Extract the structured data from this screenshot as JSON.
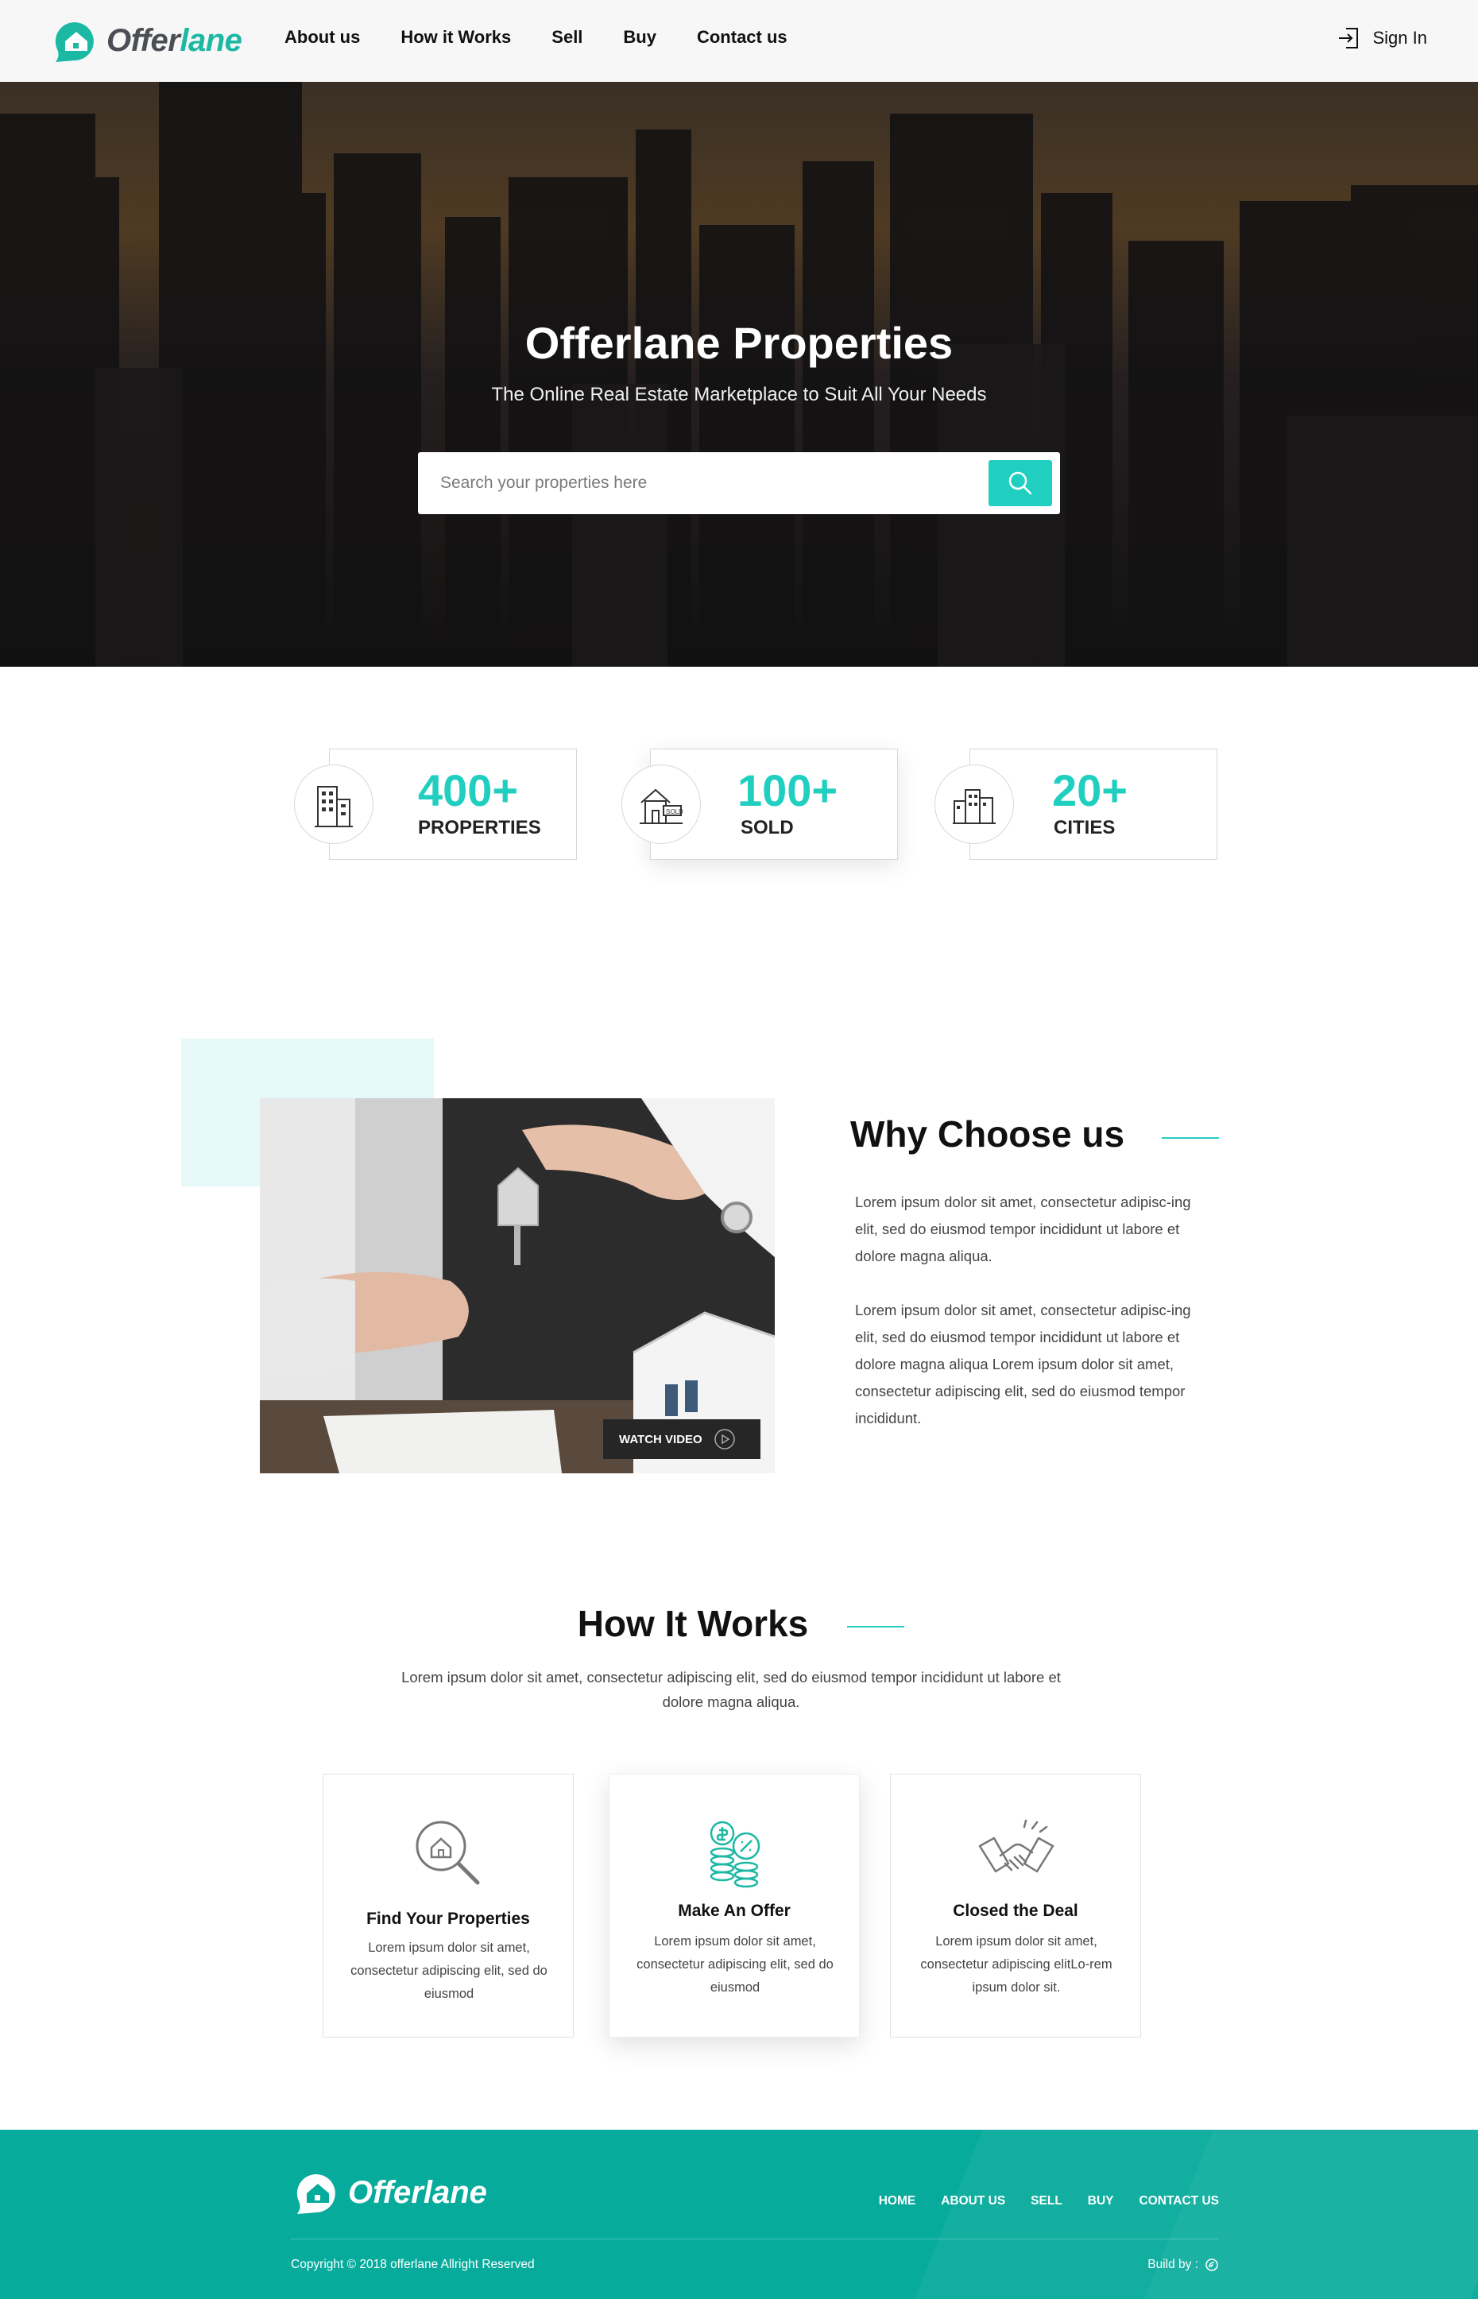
{
  "brand": {
    "name_part1": "Offer",
    "name_part2": "lane",
    "footer_name": "Offerlane",
    "accent": "#21cfc0",
    "footer_bg": "#06ab9c"
  },
  "nav": {
    "items": [
      {
        "label": "About us"
      },
      {
        "label": "How it Works"
      },
      {
        "label": "Sell"
      },
      {
        "label": "Buy"
      },
      {
        "label": "Contact us"
      }
    ],
    "signin_label": "Sign In",
    "signin_icon": "sign-in-icon"
  },
  "hero": {
    "title": "Offerlane Properties",
    "subtitle": "The Online Real Estate Marketplace to Suit All Your Needs",
    "search_placeholder": "Search your properties here",
    "search_value": "",
    "search_icon": "search-icon"
  },
  "stats": [
    {
      "value": "400+",
      "label": "PROPERTIES",
      "icon": "buildings-icon"
    },
    {
      "value": "100+",
      "label": "SOLD",
      "icon": "sold-house-icon"
    },
    {
      "value": "20+",
      "label": "CITIES",
      "icon": "city-icon"
    }
  ],
  "why": {
    "title": "Why Choose us",
    "paragraph1": "Lorem ipsum dolor sit amet, consectetur adipisc-ing elit, sed do eiusmod tempor incididunt ut labore et dolore magna aliqua.",
    "paragraph2": "Lorem ipsum dolor sit amet, consectetur adipisc-ing elit, sed do eiusmod tempor incididunt ut labore et dolore magna aliqua Lorem ipsum dolor sit amet, consectetur adipiscing elit, sed do eiusmod tempor incididunt.",
    "watch_label": "WATCH VIDEO"
  },
  "how": {
    "title": "How It Works",
    "description": "Lorem ipsum dolor sit amet, consectetur adipiscing elit, sed do eiusmod tempor incididunt ut labore et dolore magna aliqua.",
    "cards": [
      {
        "title": "Find Your Properties",
        "text": "Lorem ipsum dolor sit amet, consectetur adipiscing elit, sed do eiusmod",
        "icon": "house-search-icon"
      },
      {
        "title": "Make An Offer",
        "text": "Lorem ipsum dolor sit amet, consectetur adipiscing elit, sed do eiusmod",
        "icon": "coins-offer-icon"
      },
      {
        "title": "Closed the Deal",
        "text": "Lorem ipsum dolor sit amet, consectetur adipiscing elitLo-rem ipsum dolor sit.",
        "icon": "handshake-icon"
      }
    ]
  },
  "footer": {
    "nav": [
      {
        "label": "HOME"
      },
      {
        "label": "ABOUT US"
      },
      {
        "label": "SELL"
      },
      {
        "label": "BUY"
      },
      {
        "label": "CONTACT US"
      }
    ],
    "copyright": "Copyright © 2018 offerlane Allright Reserved",
    "build_by": "Build by :"
  }
}
